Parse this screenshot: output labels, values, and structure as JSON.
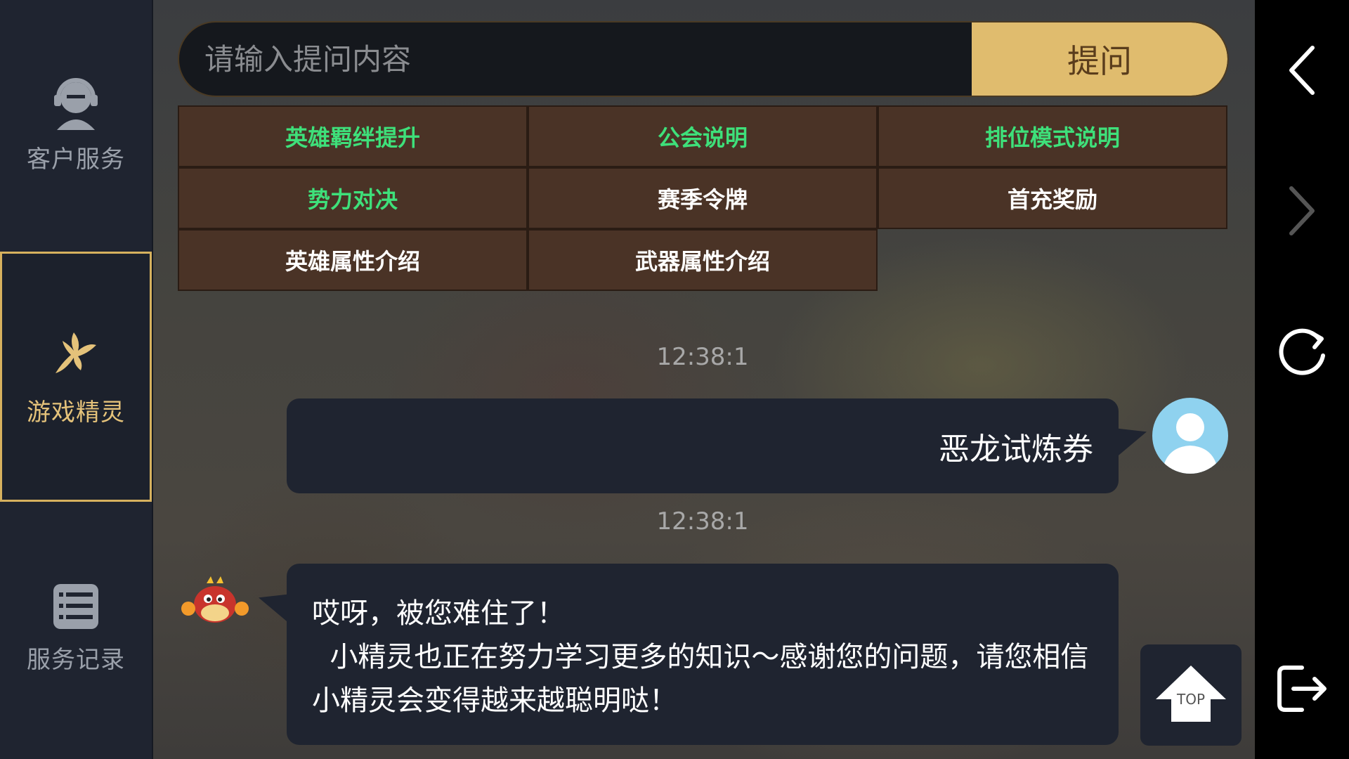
{
  "sidebar": {
    "items": [
      {
        "label": "客户服务",
        "icon": "headset-icon",
        "active": false
      },
      {
        "label": "游戏精灵",
        "icon": "fairy-icon",
        "active": true
      },
      {
        "label": "服务记录",
        "icon": "list-icon",
        "active": false
      }
    ]
  },
  "search": {
    "placeholder": "请输入提问内容",
    "value": "",
    "button_label": "提问"
  },
  "topics": [
    {
      "label": "英雄羁绊提升",
      "color": "#3ee07a"
    },
    {
      "label": "公会说明",
      "color": "#3ee07a"
    },
    {
      "label": "排位模式说明",
      "color": "#3ee07a"
    },
    {
      "label": "势力对决",
      "color": "#3ee07a"
    },
    {
      "label": "赛季令牌",
      "color": "#ffffff"
    },
    {
      "label": "首充奖励",
      "color": "#ffffff"
    },
    {
      "label": "英雄属性介绍",
      "color": "#ffffff"
    },
    {
      "label": "武器属性介绍",
      "color": "#ffffff"
    }
  ],
  "chat": {
    "messages": [
      {
        "timestamp": "12:38:1",
        "sender": "user",
        "text": "恶龙试炼券"
      },
      {
        "timestamp": "12:38:1",
        "sender": "bot",
        "text": "哎呀，被您难住了！\n  小精灵也正在努力学习更多的知识～感谢您的问题，请您相信小精灵会变得越来越聪明哒！"
      }
    ]
  },
  "top_button": {
    "label": "TOP"
  },
  "right_nav": {
    "items": [
      "back-arrow-icon",
      "forward-arrow-icon",
      "refresh-icon",
      "exit-icon"
    ]
  },
  "colors": {
    "accent": "#e0bc6e",
    "topic_bg": "#4a3326",
    "sidebar_bg": "#1f2430",
    "green_text": "#3ee07a"
  }
}
